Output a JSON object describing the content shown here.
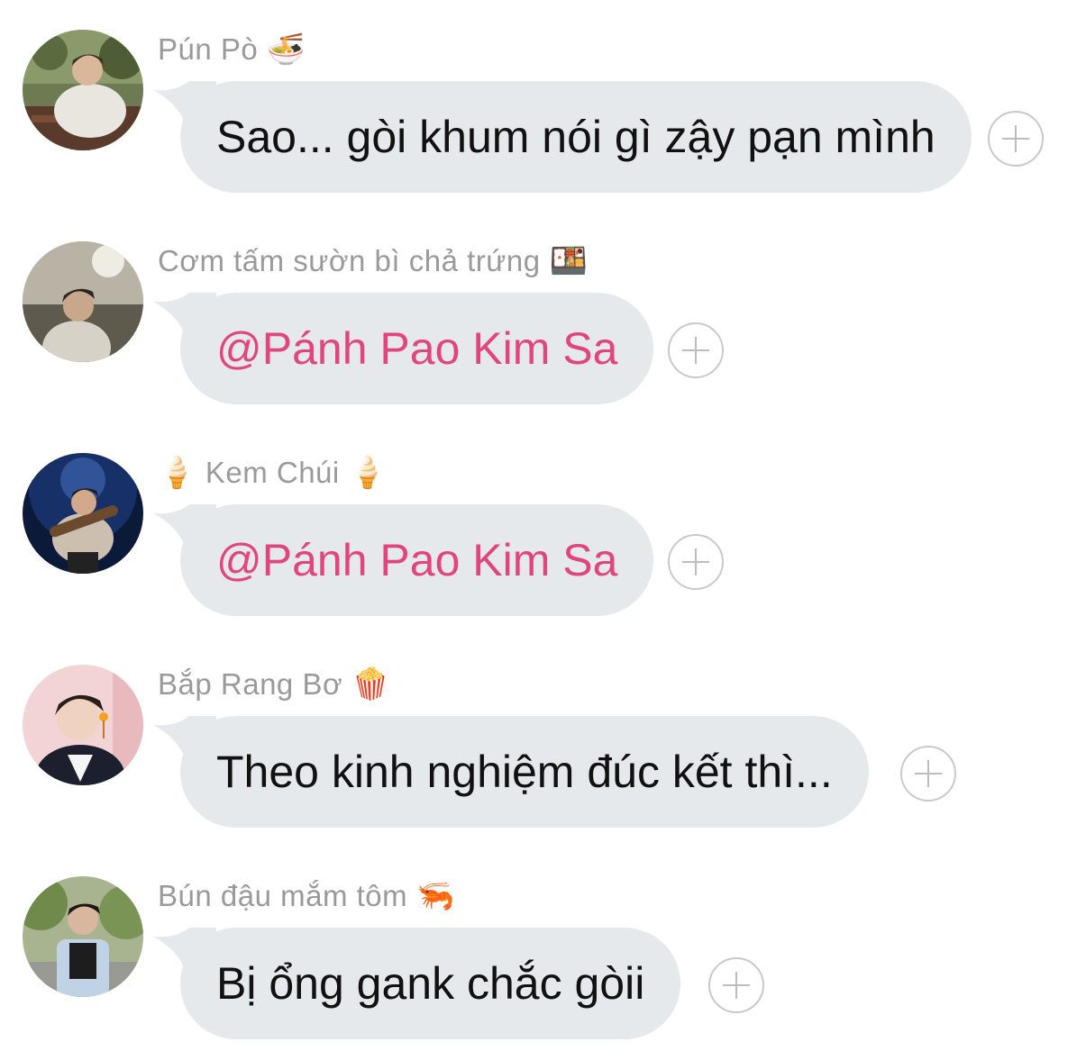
{
  "messages": [
    {
      "sender": "Pún Pò",
      "sender_emoji_before": "",
      "sender_emoji_after": "🍜",
      "text": "Sao... gòi khum nói gì zậy pạn mình",
      "mention": false
    },
    {
      "sender": "Cơm tấm sườn bì chả trứng",
      "sender_emoji_before": "",
      "sender_emoji_after": "🍱",
      "text": "@Pánh Pao Kim Sa",
      "mention": true
    },
    {
      "sender": "Kem Chúi",
      "sender_emoji_before": "🍦",
      "sender_emoji_after": "🍦",
      "text": "@Pánh Pao Kim Sa",
      "mention": true
    },
    {
      "sender": "Bắp Rang Bơ",
      "sender_emoji_before": "",
      "sender_emoji_after": "🍿",
      "text": "Theo kinh nghiệm đúc kết thì...",
      "mention": false
    },
    {
      "sender": "Bún đậu mắm tôm",
      "sender_emoji_before": "",
      "sender_emoji_after": "🦐",
      "text": "Bị ổng gank chắc gòii",
      "mention": false
    }
  ],
  "colors": {
    "bubble": "#e6e9ec",
    "mention": "#e0457f",
    "sender": "#9a9a9c"
  },
  "icons": {
    "react": "add-reaction-icon"
  }
}
